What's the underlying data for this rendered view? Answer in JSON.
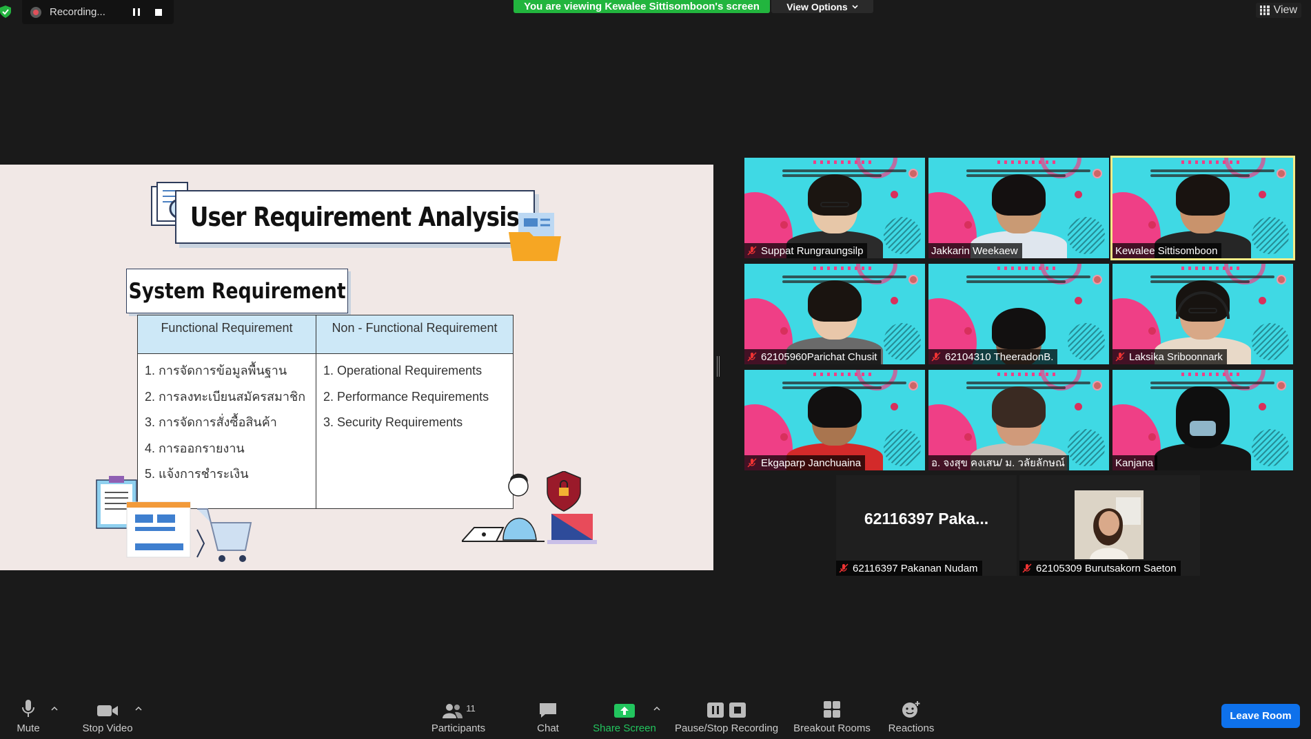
{
  "top_bar": {
    "recording_label": "Recording...",
    "viewing_banner": "You are viewing Kewalee Sittisomboon's screen",
    "view_options": "View Options",
    "view_label": "View"
  },
  "slide": {
    "title": "User Requirement Analysis",
    "subtitle": "System Requirement",
    "columns": [
      "Functional Requirement",
      "Non - Functional Requirement"
    ],
    "functional": [
      "1. การจัดการข้อมูลพื้นฐาน",
      "2. การลงทะเบียนสมัครสมาชิก",
      "3. การจัดการสั่งซื้อสินค้า",
      "4. การออกรายงาน",
      "5. แจ้งการชำระเงิน"
    ],
    "non_functional": [
      "1. Operational Requirements",
      "2. Performance Requirements",
      "3. Security Requirements"
    ]
  },
  "participants": [
    {
      "name": "Suppat Rungraungsilp",
      "muted": true
    },
    {
      "name": "Jakkarin Weekaew",
      "muted": false
    },
    {
      "name": "Kewalee Sittisomboon",
      "muted": false,
      "active": true
    },
    {
      "name": "62105960Parichat Chusit",
      "muted": true
    },
    {
      "name": "62104310 TheeradonB.",
      "muted": true
    },
    {
      "name": "Laksika Sriboonnark",
      "muted": true
    },
    {
      "name": "Ekgaparp Janchuaina",
      "muted": true
    },
    {
      "name": "อ. จงสุข คงเสน/ ม. วลัยลักษณ์",
      "muted": false
    },
    {
      "name": "Kanjana",
      "muted": false
    }
  ],
  "no_video": [
    {
      "display": "62116397 Paka...",
      "name": "62116397 Pakanan Nudam",
      "muted": true
    },
    {
      "name": "62105309 Burutsakorn Saeton",
      "muted": true
    }
  ],
  "toolbar": {
    "mute": "Mute",
    "stop_video": "Stop Video",
    "participants": "Participants",
    "participants_count": "11",
    "chat": "Chat",
    "share_screen": "Share Screen",
    "pause_stop_recording": "Pause/Stop Recording",
    "breakout_rooms": "Breakout Rooms",
    "reactions": "Reactions",
    "leave_room": "Leave Room"
  },
  "colors": {
    "background": "#1a1a1a",
    "banner_green": "#22b53e",
    "tile_cyan": "#3fd9e4",
    "tile_pink": "#ef3f86",
    "active_border": "#f4ec87",
    "leave_blue": "#0e71eb",
    "share_green": "#22c55e"
  }
}
